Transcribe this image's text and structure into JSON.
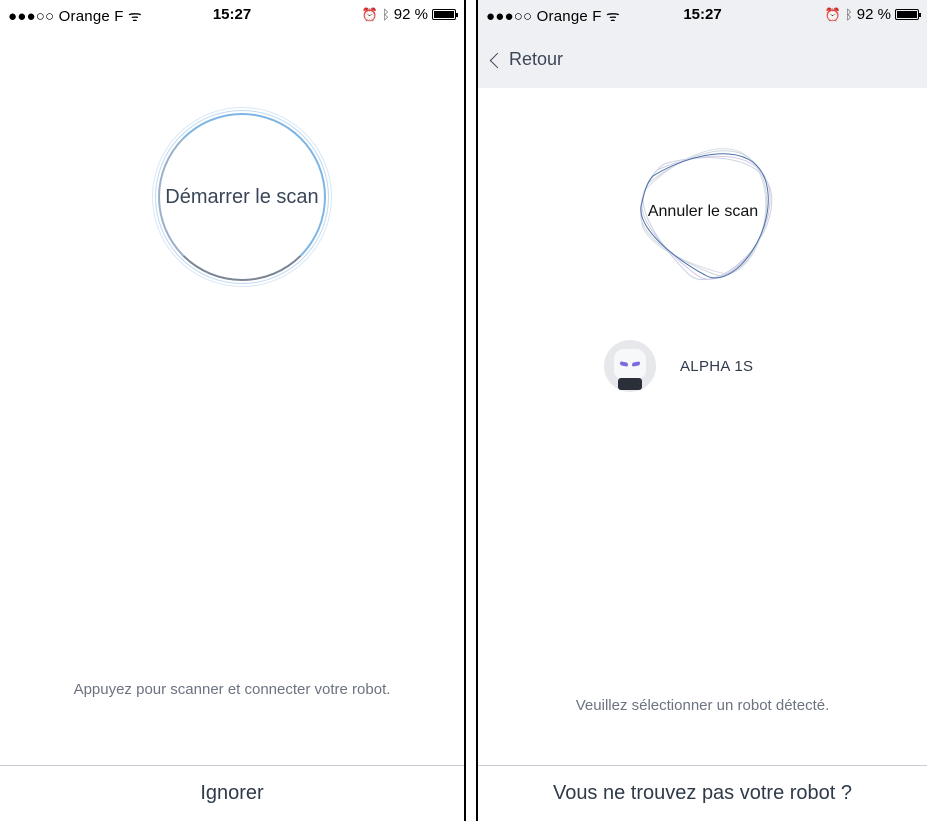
{
  "left": {
    "status": {
      "carrier": "●●●○○ Orange F",
      "time": "15:27",
      "battery": "92 %"
    },
    "scan_button": "Démarrer le scan",
    "hint": "Appuyez pour scanner et connecter votre robot.",
    "bottom_action": "Ignorer"
  },
  "right": {
    "status": {
      "carrier": "●●●○○ Orange F",
      "time": "15:27",
      "battery": "92 %"
    },
    "nav": {
      "back_label": "Retour"
    },
    "cancel_button": "Annuler le scan",
    "robots": [
      {
        "name": "ALPHA 1S"
      }
    ],
    "hint": "Veuillez sélectionner un robot détecté.",
    "bottom_action": "Vous ne trouvez pas votre robot ?"
  },
  "icons": {
    "wifi": "wifi-icon",
    "alarm": "alarm-icon",
    "bluetooth": "bluetooth-icon",
    "battery": "battery-icon",
    "back": "chevron-left-icon"
  },
  "colors": {
    "ring_blue": "#7fb5e4",
    "nav_bg": "#eef0f3",
    "robot_eye": "#7b6ae0"
  }
}
